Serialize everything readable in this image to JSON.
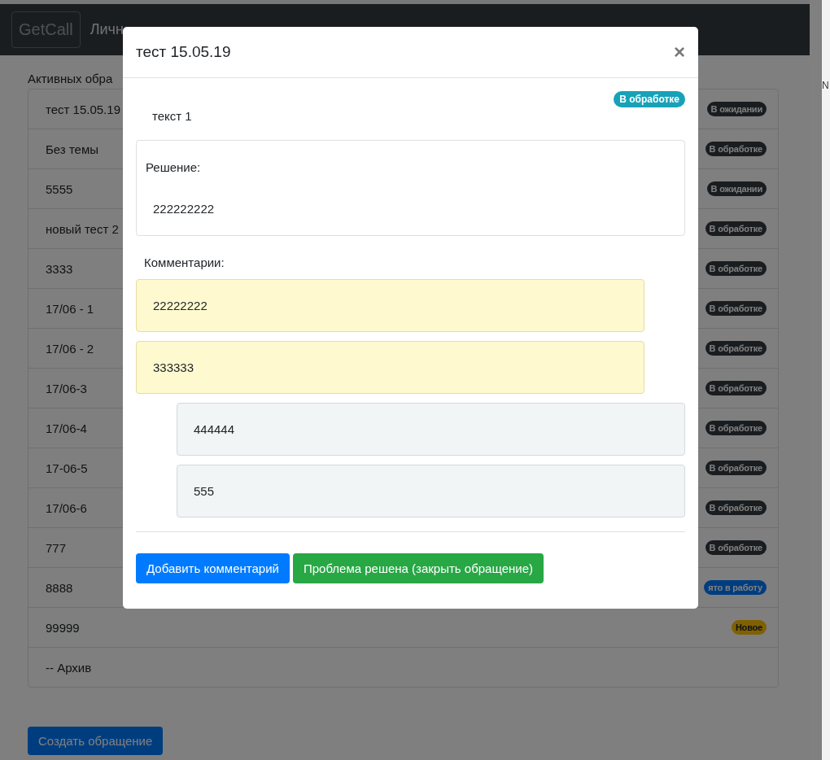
{
  "navbar": {
    "brand": "GetCall",
    "title": "Личн"
  },
  "active_requests": {
    "heading": "Активных обра",
    "items": [
      {
        "text": "тест 15.05.19",
        "badge": {
          "text": "В ожидании",
          "kind": "dark"
        }
      },
      {
        "text": "Без темы",
        "badge": {
          "text": "В обработке",
          "kind": "dark"
        }
      },
      {
        "text": "5555",
        "badge": {
          "text": "В ожидании",
          "kind": "dark"
        }
      },
      {
        "text": "новый тест 2",
        "badge": {
          "text": "В обработке",
          "kind": "dark"
        }
      },
      {
        "text": "3333",
        "badge": {
          "text": "В обработке",
          "kind": "dark"
        }
      },
      {
        "text": "17/06 - 1",
        "badge": {
          "text": "В обработке",
          "kind": "dark"
        }
      },
      {
        "text": "17/06 - 2",
        "badge": {
          "text": "В обработке",
          "kind": "dark"
        }
      },
      {
        "text": "17/06-3",
        "badge": {
          "text": "В обработке",
          "kind": "dark"
        }
      },
      {
        "text": "17/06-4",
        "badge": {
          "text": "В обработке",
          "kind": "dark"
        }
      },
      {
        "text": "17-06-5",
        "badge": {
          "text": "В обработке",
          "kind": "dark"
        }
      },
      {
        "text": "17/06-6",
        "badge": {
          "text": "В обработке",
          "kind": "dark"
        }
      },
      {
        "text": "777",
        "badge": {
          "text": "В обработке",
          "kind": "dark"
        }
      },
      {
        "text": "8888",
        "badge": {
          "text": "ято в работу",
          "kind": "primary"
        }
      },
      {
        "text": "99999",
        "badge": {
          "text": "Новое",
          "kind": "warning"
        }
      },
      {
        "text": "-- Архив"
      }
    ]
  },
  "create_button": "Создать обращение",
  "side_panel": {
    "text": "N"
  },
  "modal": {
    "title": "тест 15.05.19",
    "close": "×",
    "status": {
      "text": "В обработке",
      "kind": "info"
    },
    "description": "текст 1",
    "solution": {
      "label": "Решение:",
      "text": "222222222"
    },
    "comments_label": "Комментарии:",
    "comments": [
      {
        "text": "22222222",
        "kind": "highlighted"
      },
      {
        "text": "333333",
        "kind": "highlighted"
      },
      {
        "text": "444444",
        "kind": "indented"
      },
      {
        "text": "555",
        "kind": "indented"
      }
    ],
    "buttons": [
      {
        "label": "Добавить комментарий",
        "kind": "primary"
      },
      {
        "label": "Проблема решена (закрыть обращение)",
        "kind": "success"
      }
    ]
  }
}
